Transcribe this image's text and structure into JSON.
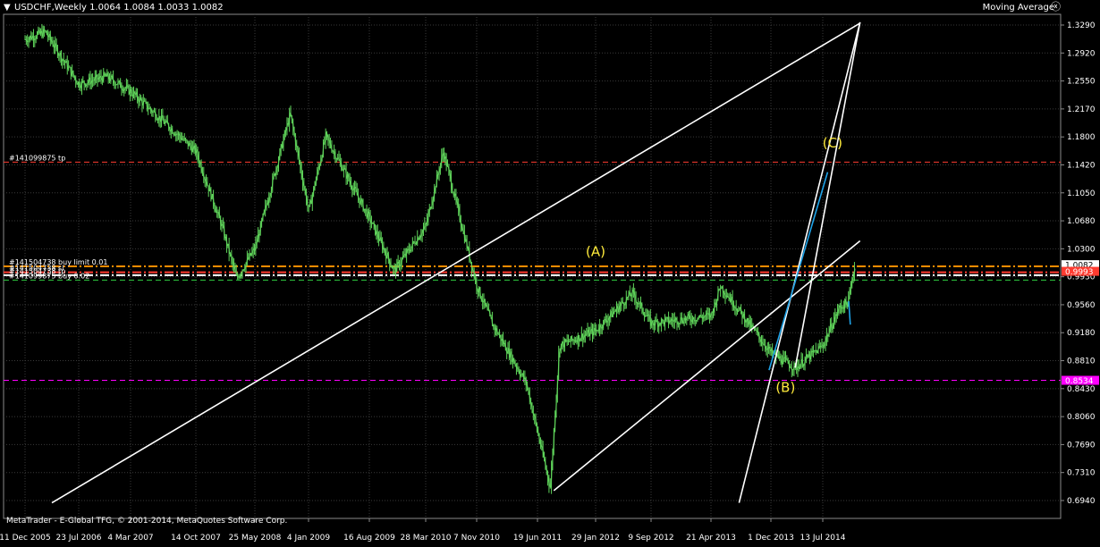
{
  "header": {
    "title": "USDCHF,Weekly  1.0064 1.0084 1.0033 1.0082",
    "indicator": "Moving Average",
    "menu_icon": "triangle-down-icon",
    "close_icon": "circle-x-icon"
  },
  "footer": {
    "copyright": "MetaTrader - E-Global TFG, © 2001-2014, MetaQuotes Software Corp."
  },
  "colors": {
    "background": "#000000",
    "grid": "#3a3a3a",
    "candles": "#5fd35a",
    "trendlines": "#ffffff",
    "wave_lines": "#1fa3e8",
    "wave_labels": "#ffeb3b",
    "tp_line": "#ff3b30",
    "buy_limit_line": "#ff8c00",
    "sell_stop_line": "#ffffff",
    "buy_stop_line": "#2ecc40",
    "support_line": "#ff00ff"
  },
  "chart_data": {
    "type": "candlestick",
    "symbol": "USDCHF",
    "timeframe": "Weekly",
    "ohlc_last": {
      "open": 1.0064,
      "high": 1.0084,
      "low": 1.0033,
      "close": 1.0082
    },
    "ylim": [
      0.6925,
      1.329
    ],
    "ytick_labels": [
      "1.3290",
      "1.2920",
      "1.2550",
      "1.2170",
      "1.1800",
      "1.1420",
      "1.1050",
      "1.0680",
      "1.0300",
      "0.9930",
      "0.9560",
      "0.9180",
      "0.8810",
      "0.8430",
      "0.8060",
      "0.7690",
      "0.7310",
      "0.6940"
    ],
    "xtick_labels": [
      "11 Dec 2005",
      "23 Jul 2006",
      "4 Mar 2007",
      "14 Oct 2007",
      "25 May 2008",
      "4 Jan 2009",
      "16 Aug 2009",
      "28 Mar 2010",
      "7 Nov 2010",
      "19 Jun 2011",
      "29 Jan 2012",
      "9 Sep 2012",
      "21 Apr 2013",
      "1 Dec 2013",
      "13 Jul 2014"
    ],
    "price_path": [
      [
        "11 Dec 2005",
        1.31
      ],
      [
        "5 Mar 2006",
        1.32
      ],
      [
        "23 Jul 2006",
        1.25
      ],
      [
        "19 Nov 2006",
        1.26
      ],
      [
        "4 Mar 2007",
        1.24
      ],
      [
        "14 Oct 2007",
        1.16
      ],
      [
        "20 Jan 2008",
        1.06
      ],
      [
        "16 Mar 2008",
        0.99
      ],
      [
        "25 May 2008",
        1.03
      ],
      [
        "19 Oct 2008",
        1.21
      ],
      [
        "4 Jan 2009",
        1.08
      ],
      [
        "8 Mar 2009",
        1.18
      ],
      [
        "16 Aug 2009",
        1.07
      ],
      [
        "22 Nov 2009",
        1.0
      ],
      [
        "28 Mar 2010",
        1.06
      ],
      [
        "13 Jun 2010",
        1.16
      ],
      [
        "7 Nov 2010",
        0.98
      ],
      [
        "2 Jan 2011",
        0.93
      ],
      [
        "8 May 2011",
        0.85
      ],
      [
        "7 Aug 2011",
        0.71
      ],
      [
        "11 Sep 2011",
        0.9
      ],
      [
        "29 Jan 2012",
        0.92
      ],
      [
        "24 Jun 2012",
        0.97
      ],
      [
        "9 Sep 2012",
        0.93
      ],
      [
        "21 Apr 2013",
        0.94
      ],
      [
        "26 May 2013",
        0.98
      ],
      [
        "1 Dec 2013",
        0.89
      ],
      [
        "16 Mar 2014",
        0.87
      ],
      [
        "13 Jul 2014",
        0.9
      ],
      [
        "21 Sep 2014",
        0.95
      ],
      [
        "2 Nov 2014",
        0.9593
      ],
      [
        "16 Nov 2014",
        0.99
      ],
      [
        "30 Nov 2014",
        1.0082
      ]
    ],
    "horizontal_lines": [
      {
        "label": "#141099875 tp",
        "price": 1.1455,
        "color": "tp_line",
        "style": "dashed"
      },
      {
        "label": "#141504738 buy limit 0.01",
        "price": 1.006,
        "color": "buy_limit_line",
        "style": "dashdot"
      },
      {
        "label": "#141504738 sl",
        "price": 0.998,
        "color": "tp_line",
        "style": "dashdot"
      },
      {
        "label": "#141504738 tp",
        "price": 0.9942,
        "color": "sell_stop_line",
        "style": "dashdot"
      },
      {
        "label": "#141099875 buy 0.02",
        "price": 0.9875,
        "color": "buy_stop_line",
        "style": "dashed"
      },
      {
        "label": "",
        "price": 0.8534,
        "color": "support_line",
        "style": "dashed"
      }
    ],
    "price_tags": [
      {
        "text": "1.0082",
        "price": 1.0082,
        "bg": "#ffffff",
        "fg": "#000000"
      },
      {
        "text": "0.9993",
        "price": 0.9993,
        "bg": "#ff3b30",
        "fg": "#ffffff"
      },
      {
        "text": "0.8534",
        "price": 0.8534,
        "bg": "#ff00ff",
        "fg": "#ffffff"
      }
    ],
    "trendlines": [
      {
        "from": [
          "2 Apr 2006",
          0.6894
        ],
        "to": [
          "21 Dec 2014",
          1.3315
        ]
      },
      {
        "from": [
          "21 Aug 2011",
          0.7058
        ],
        "to": [
          "21 Dec 2014",
          1.04
        ]
      },
      {
        "from": [
          "4 Aug 2013",
          0.6894
        ],
        "to": [
          "21 Dec 2014",
          1.3327
        ]
      },
      {
        "from": [
          "16 Mar 2014",
          0.8703
        ],
        "to": [
          "21 Dec 2014",
          1.3327
        ]
      }
    ],
    "wave_lines": [
      {
        "from": [
          "24 Nov 2013",
          0.867
        ],
        "to": [
          "3 Aug 2014",
          1.132
        ]
      },
      {
        "from": [
          "2 Nov 2014",
          0.9593
        ],
        "to": [
          "9 Nov 2014",
          0.928
        ]
      }
    ],
    "wave_labels": [
      {
        "text": "(A)",
        "at": [
          "29 Jan 2012",
          1.02
        ]
      },
      {
        "text": "(B)",
        "at": [
          "2 Feb 2014",
          0.838
        ]
      },
      {
        "text": "(C)",
        "at": [
          "24 Aug 2014",
          1.165
        ]
      }
    ]
  }
}
